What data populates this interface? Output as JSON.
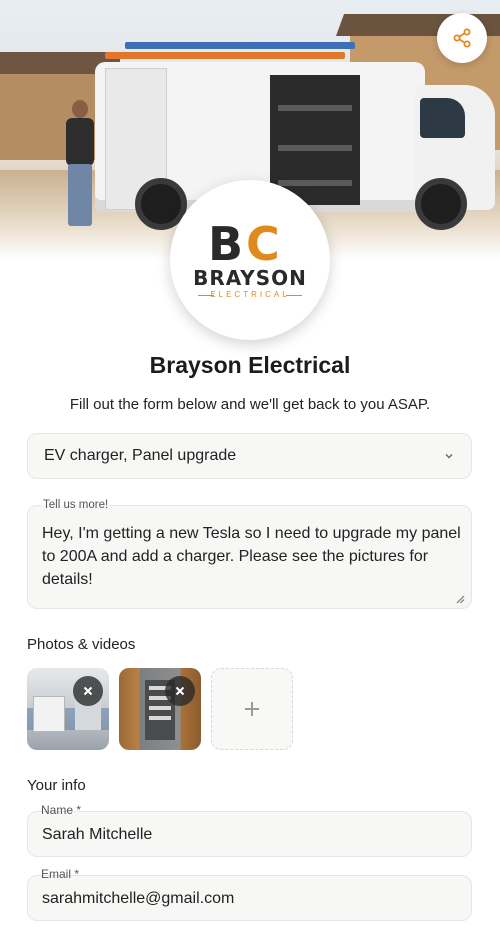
{
  "business": {
    "name": "Brayson Electrical",
    "logo_wordmark": "BRAYSON",
    "logo_subtitle": "ELECTRICAL",
    "logo_initials": "BC",
    "brand_color": "#e08a1e",
    "dark_color": "#2a2a2a"
  },
  "share": {
    "icon": "share-icon"
  },
  "form": {
    "intro": "Fill out the form below and we'll get back to you ASAP.",
    "service_select": {
      "value": "EV charger, Panel upgrade",
      "icon": "chevron-down-icon"
    },
    "details": {
      "label": "Tell us more!",
      "value": "Hey, I'm getting a new Tesla so I need to upgrade my panel to 200A and add a charger. Please see the pictures for details!"
    },
    "media": {
      "title": "Photos & videos",
      "items": [
        {
          "name": "garage-photo",
          "remove_icon": "close-icon"
        },
        {
          "name": "panel-photo",
          "remove_icon": "close-icon"
        }
      ],
      "add_icon": "plus-icon"
    },
    "your_info": {
      "title": "Your info",
      "name": {
        "label": "Name *",
        "value": "Sarah Mitchelle"
      },
      "email": {
        "label": "Email *",
        "value": "sarahmitchelle@gmail.com"
      }
    }
  }
}
